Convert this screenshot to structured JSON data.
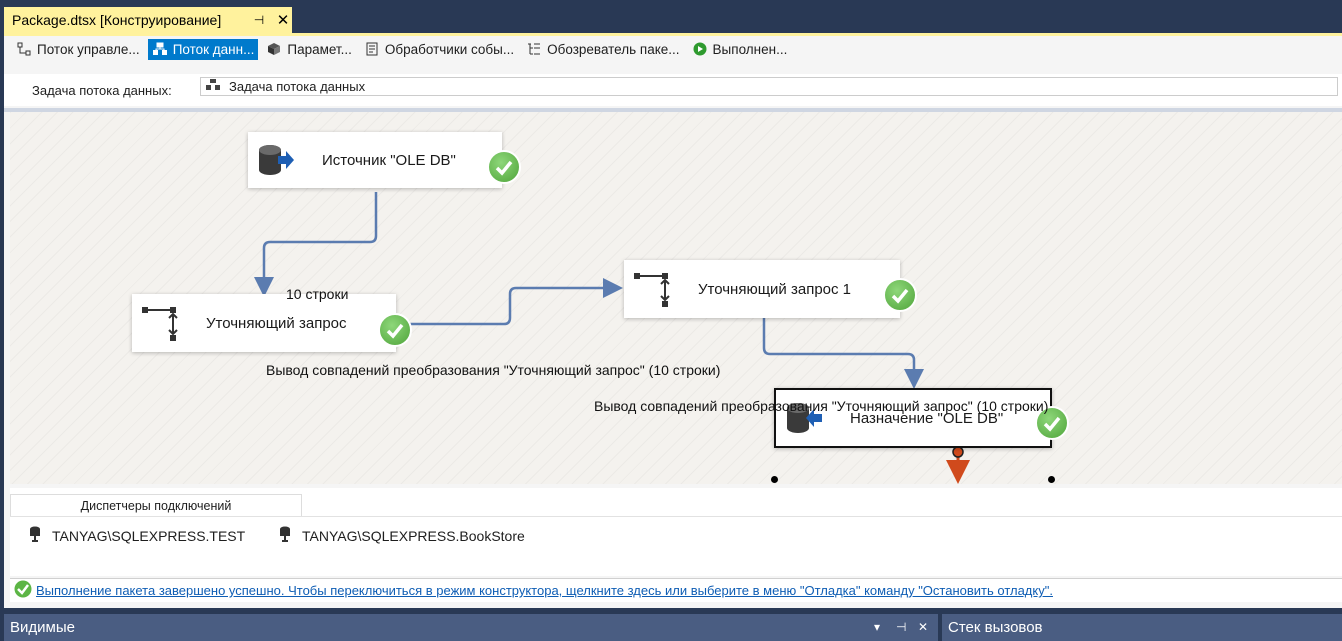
{
  "document_tab": {
    "title": "Package.dtsx [Конструирование]",
    "pin": "ꟷ",
    "close": "✕"
  },
  "designer_tabs": [
    {
      "label": "Поток управле...",
      "icon": "control-flow-icon",
      "active": false
    },
    {
      "label": "Поток данн...",
      "icon": "data-flow-icon",
      "active": true
    },
    {
      "label": "Парамет...",
      "icon": "parameters-icon",
      "active": false
    },
    {
      "label": "Обработчики собы...",
      "icon": "event-handlers-icon",
      "active": false
    },
    {
      "label": "Обозреватель паке...",
      "icon": "package-explorer-icon",
      "active": false
    },
    {
      "label": "Выполнен...",
      "icon": "execution-results-icon",
      "active": false
    }
  ],
  "task_selector": {
    "label": "Задача потока данных:",
    "value": "Задача потока данных"
  },
  "components": {
    "source": {
      "label": "Источник \"OLE DB\"",
      "status": "success"
    },
    "lookup": {
      "label": "Уточняющий запрос",
      "status": "success"
    },
    "lookup1": {
      "label": "Уточняющий запрос 1",
      "status": "success"
    },
    "destination": {
      "label": "Назначение \"OLE DB\"",
      "status": "success"
    }
  },
  "paths": {
    "p1": "10 строки",
    "p2": "Вывод совпадений преобразования \"Уточняющий запрос\" (10 строки)",
    "p3": "Вывод совпадений преобразования \"Уточняющий запрос\" (10 строки)"
  },
  "connection_managers": {
    "tab_label": "Диспетчеры подключений",
    "items": [
      "TANYAG\\SQLEXPRESS.TEST",
      "TANYAG\\SQLEXPRESS.BookStore"
    ]
  },
  "status_message": "Выполнение пакета завершено успешно. Чтобы переключиться в режим конструктора, щелкните здесь или выберите в меню \"Отладка\" команду \"Остановить отладку\".",
  "bottom_panels": {
    "left": "Видимые",
    "right": "Стек вызовов"
  },
  "colors": {
    "accent": "#007acc",
    "tab_yellow": "#fff29d",
    "path_blue": "#5b7cb0",
    "error_path": "#d04a1c",
    "success_green": "#5cb545"
  }
}
